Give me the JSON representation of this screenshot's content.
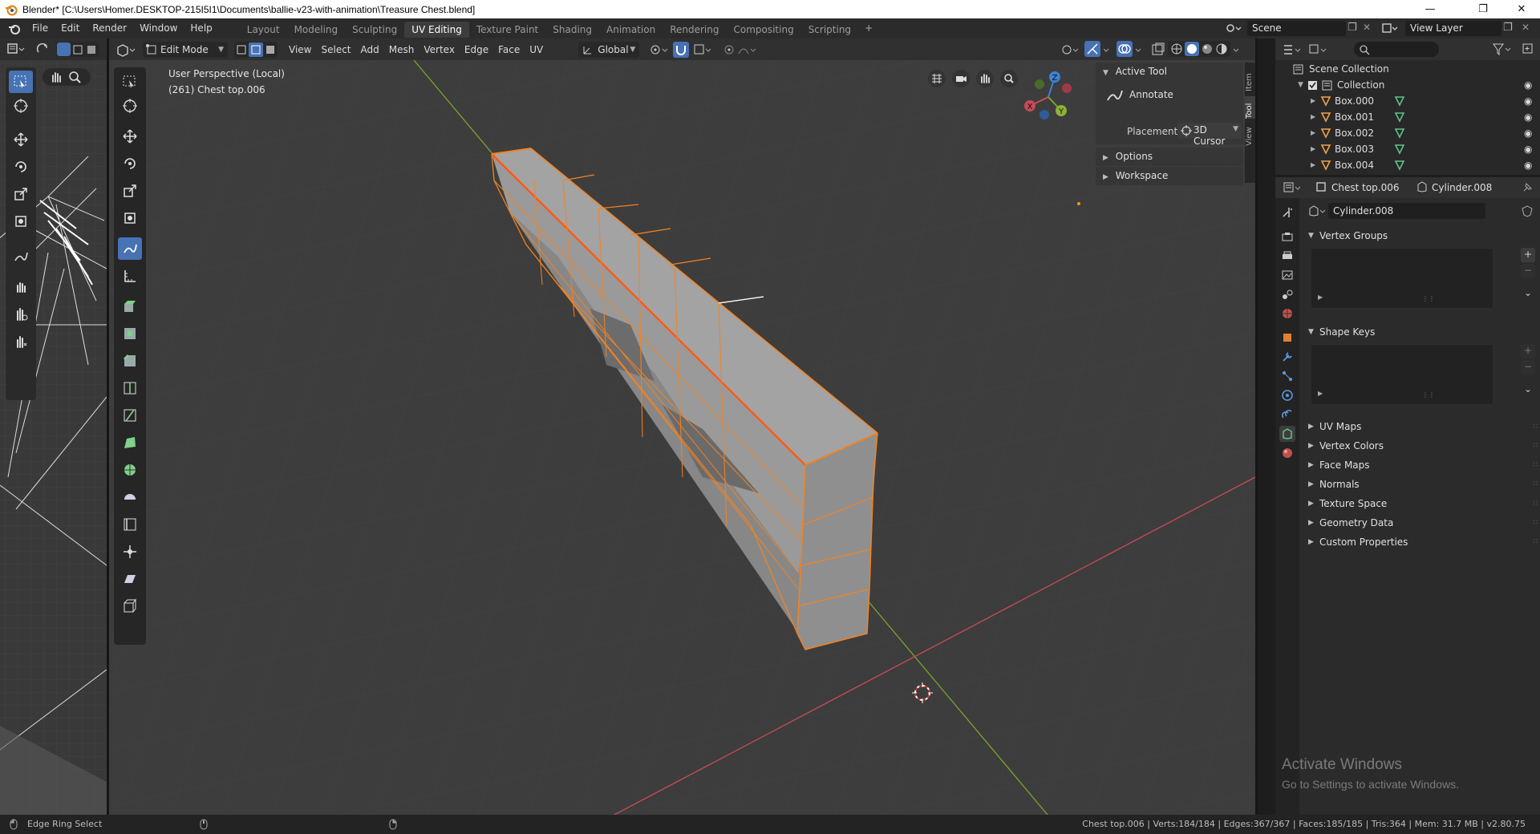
{
  "window": {
    "title": "Blender* [C:\\Users\\Homer.DESKTOP-215I5I1\\Documents\\ballie-v23-with-animation\\Treasure Chest.blend]"
  },
  "menu": [
    "File",
    "Edit",
    "Render",
    "Window",
    "Help"
  ],
  "workspaces": [
    {
      "label": "Layout",
      "active": false
    },
    {
      "label": "Modeling",
      "active": false
    },
    {
      "label": "Sculpting",
      "active": false
    },
    {
      "label": "UV Editing",
      "active": true
    },
    {
      "label": "Texture Paint",
      "active": false
    },
    {
      "label": "Shading",
      "active": false
    },
    {
      "label": "Animation",
      "active": false
    },
    {
      "label": "Rendering",
      "active": false
    },
    {
      "label": "Compositing",
      "active": false
    },
    {
      "label": "Scripting",
      "active": false
    }
  ],
  "add_workspace": "+",
  "scene": {
    "label": "Scene"
  },
  "view_layer": {
    "label": "View Layer"
  },
  "viewport": {
    "mode": "Edit Mode",
    "menus": [
      "View",
      "Select",
      "Add",
      "Mesh",
      "Vertex",
      "Edge",
      "Face",
      "UV"
    ],
    "orientation": "Global",
    "overlay_line1": "User Perspective (Local)",
    "overlay_line2": "(261) Chest top.006",
    "gizmo_axes": {
      "x": "X",
      "y": "Y",
      "z": "Z"
    }
  },
  "npanel": {
    "active_tool_header": "Active Tool",
    "tool_name": "Annotate",
    "placement_label": "Placement",
    "placement_value": "3D Cursor",
    "options": "Options",
    "workspace": "Workspace",
    "tabs": [
      "Item",
      "Tool",
      "View"
    ]
  },
  "outliner": {
    "root": "Scene Collection",
    "collection": "Collection",
    "items": [
      "Box.000",
      "Box.001",
      "Box.002",
      "Box.003",
      "Box.004"
    ]
  },
  "properties": {
    "object_name": "Chest top.006",
    "mesh_name": "Cylinder.008",
    "datablock": "Cylinder.008",
    "panels_open": [
      "Vertex Groups",
      "Shape Keys"
    ],
    "panels_closed": [
      "UV Maps",
      "Vertex Colors",
      "Face Maps",
      "Normals",
      "Texture Space",
      "Geometry Data",
      "Custom Properties"
    ]
  },
  "statusbar": {
    "left": "Edge Ring Select",
    "right": "Chest top.006 | Verts:184/184 | Edges:367/367 | Faces:185/185 | Tris:364 | Mem: 31.7 MB | v2.80.75"
  },
  "watermark": {
    "line1": "Activate Windows",
    "line2": "Go to Settings to activate Windows."
  },
  "colors": {
    "accent": "#4772b3",
    "selection": "#f5821f",
    "active_edge": "#ff5a14",
    "axis_x": "#c94a5a",
    "axis_y": "#7aa32b",
    "axis_z": "#3b83d6"
  }
}
